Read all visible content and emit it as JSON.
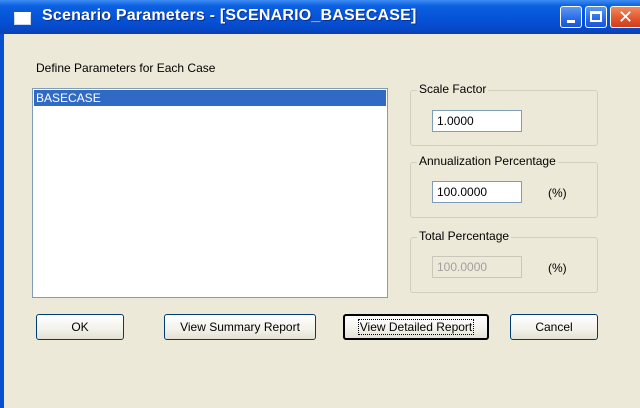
{
  "window": {
    "title": "Scenario Parameters - [SCENARIO_BASECASE]",
    "controls": [
      "minimize",
      "maximize",
      "close"
    ]
  },
  "cases": {
    "label": "Define Parameters for Each Case",
    "items": [
      "BASECASE"
    ],
    "selected": "BASECASE"
  },
  "scale_factor": {
    "label": "Scale Factor",
    "value": "1.0000"
  },
  "annualization": {
    "label": "Annualization Percentage",
    "value": "100.0000",
    "unit": "(%)"
  },
  "total_percentage": {
    "label": "Total Percentage",
    "value": "100.0000",
    "unit": "(%)",
    "disabled": true
  },
  "buttons": {
    "ok": "OK",
    "summary": "View Summary Report",
    "detailed": "View Detailed Report",
    "cancel": "Cancel"
  },
  "colors": {
    "titlebar": "#0653d8",
    "dialog_bg": "#ece9d8",
    "selection": "#316ac5"
  }
}
